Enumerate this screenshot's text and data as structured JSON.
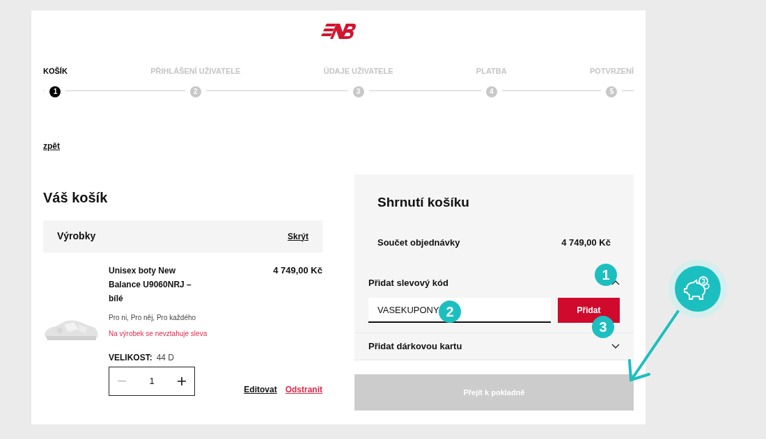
{
  "steps": [
    {
      "number": "1",
      "label": "KOŠÍK",
      "selected": true
    },
    {
      "number": "2",
      "label": "PŘIHLÁŠENÍ UŽIVATELE",
      "selected": false
    },
    {
      "number": "3",
      "label": "ÚDAJE UŽIVATELE",
      "selected": false
    },
    {
      "number": "4",
      "label": "PLATBA",
      "selected": false
    },
    {
      "number": "5",
      "label": "POTVRZENÍ",
      "selected": false
    }
  ],
  "back_link": "zpět",
  "cart": {
    "title": "Váš košík",
    "products_header": {
      "title": "Výrobky",
      "hide_link": "Skrýt"
    },
    "product": {
      "kind": "picture",
      "name": "Unisex boty New Balance U9060NRJ – bílé",
      "price": "4 749,00 Kč",
      "categories": "Pro ni, Pro něj, Pro každého",
      "discount_note": "Na výrobek se nevztahuje sleva",
      "size_label": "VELIKOST:",
      "size_value": "44 D",
      "quantity": "1",
      "decrease_disabled": true,
      "edit": "Editovat",
      "remove": "Odstranit"
    }
  },
  "summary": {
    "title": "Shrnutí košíku",
    "order_total_label": "Součet objednávky",
    "order_total_value": "4 749,00 Kč",
    "coupon_section": {
      "label": "Přidat slevový kód",
      "expanded": true,
      "marker": "1",
      "field_value": "VASEKUPONY",
      "field_marker": "2",
      "add_button": "Přidat",
      "button_marker": "3"
    },
    "gift_section": {
      "label": "Přidat dárkovou kartu",
      "expanded": false
    },
    "checkout_button": {
      "label": "Přejít k pokladně",
      "disabled": true
    }
  }
}
